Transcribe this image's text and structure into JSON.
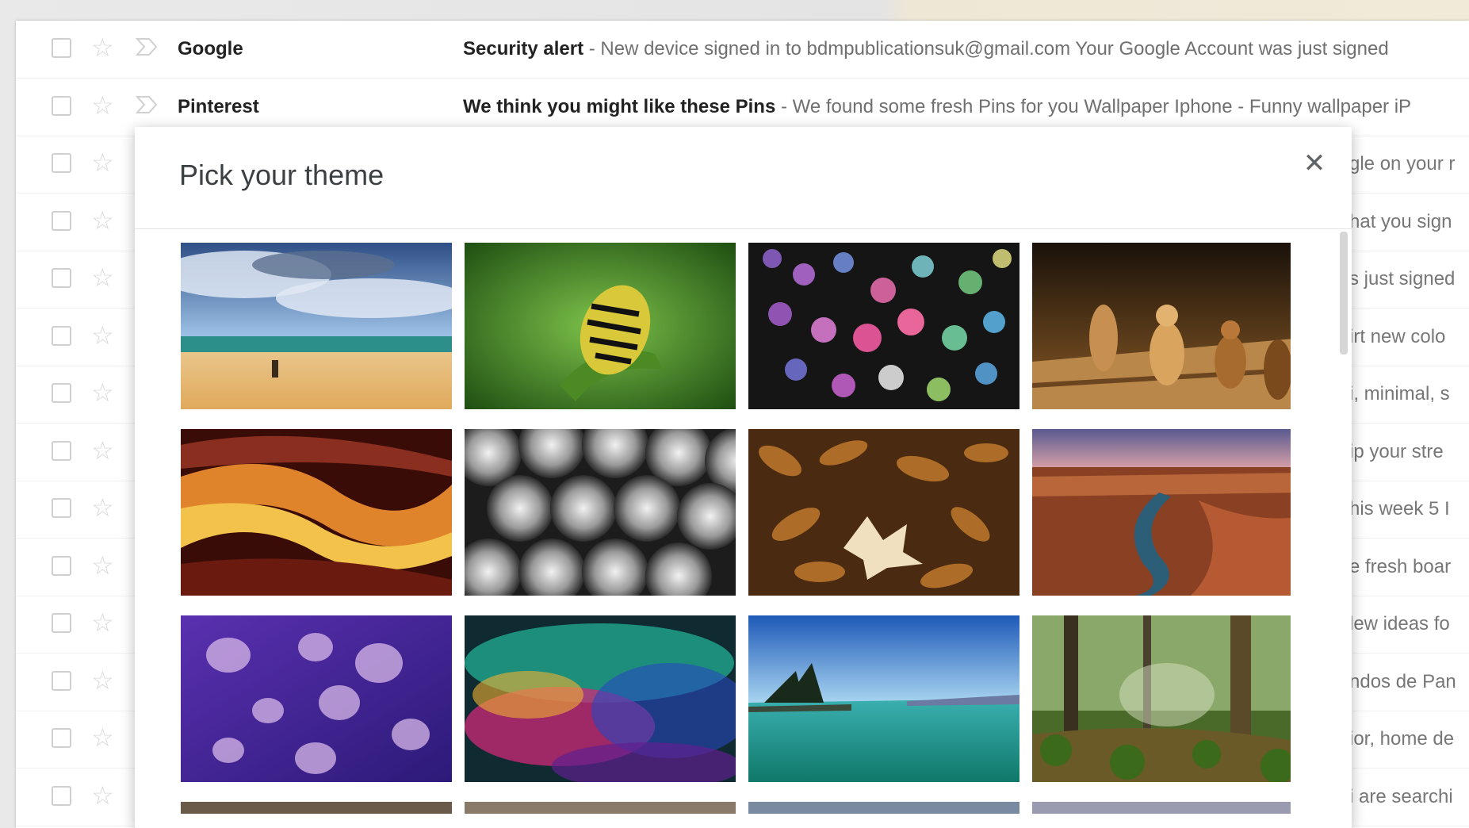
{
  "inbox": {
    "rows": [
      {
        "sender": "Google",
        "subject": "Security alert",
        "snippet": " - New device signed in to bdmpublicationsuk@gmail.com Your Google Account was just signed"
      },
      {
        "sender": "Pinterest",
        "subject": "We think you might like these Pins",
        "snippet": " - We found some fresh Pins for you Wallpaper Iphone - Funny wallpaper iP"
      }
    ],
    "right_fragments": [
      "gle on your r",
      "hat you sign",
      "s just signed",
      "irt new colo",
      "i, minimal, s",
      "ip your stre",
      "his week 5 I",
      "e fresh boar",
      "lew ideas fo",
      "ndos de Pan",
      "ior, home de",
      "i are searchi"
    ]
  },
  "theme_dialog": {
    "title": "Pick your theme",
    "close_icon": "close-icon",
    "themes": [
      {
        "name": "beach-theme"
      },
      {
        "name": "caterpillar-theme"
      },
      {
        "name": "bokeh-theme"
      },
      {
        "name": "chess-theme"
      },
      {
        "name": "canyon-theme"
      },
      {
        "name": "pipes-theme"
      },
      {
        "name": "leaves-theme"
      },
      {
        "name": "river-canyon-theme"
      },
      {
        "name": "jellyfish-theme"
      },
      {
        "name": "oil-slick-theme"
      },
      {
        "name": "lake-theme"
      },
      {
        "name": "forest-theme"
      }
    ]
  },
  "colors": {
    "accent": "#3c4043",
    "snippet": "#707070",
    "border": "#cfcfcf"
  }
}
